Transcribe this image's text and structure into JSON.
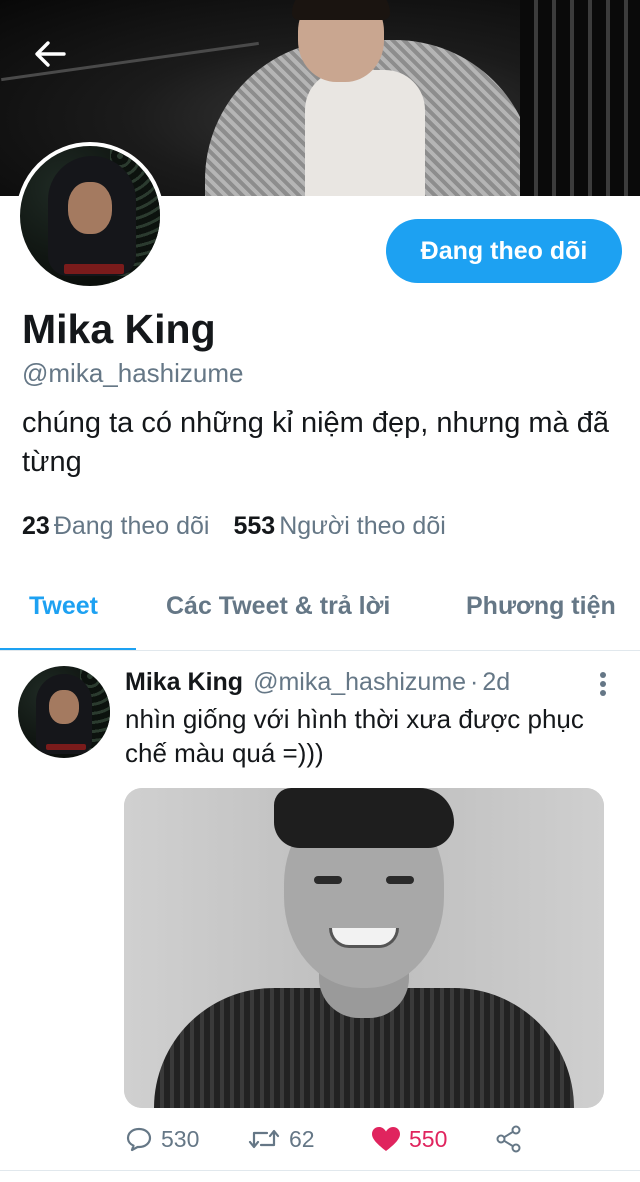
{
  "profile": {
    "display_name": "Mika King",
    "handle": "@mika_hashizume",
    "bio": "chúng ta có những kỉ niệm đẹp, nhưng mà đã từng",
    "follow_button": "Đang theo dõi",
    "following_count": "23",
    "following_label": "Đang theo dõi",
    "followers_count": "553",
    "followers_label": "Người theo dõi"
  },
  "tabs": [
    {
      "label": "Tweet",
      "active": true
    },
    {
      "label": "Các Tweet & trả lời",
      "active": false
    },
    {
      "label": "Phương tiện",
      "active": false
    }
  ],
  "tweet": {
    "name": "Mika King",
    "handle": "@mika_hashizume",
    "separator": "·",
    "time": "2d",
    "text": "nhìn giống với hình thời xưa được phục chế màu quá =)))",
    "replies": "530",
    "retweets": "62",
    "likes": "550"
  },
  "icons": {
    "back": "arrow-left-icon",
    "more": "more-vertical-icon",
    "reply": "reply-icon",
    "retweet": "retweet-icon",
    "like": "heart-filled-icon",
    "share": "share-icon"
  },
  "colors": {
    "accent": "#1da1f2",
    "like": "#e0245e",
    "secondary_text": "#657786",
    "primary_text": "#14171a"
  }
}
